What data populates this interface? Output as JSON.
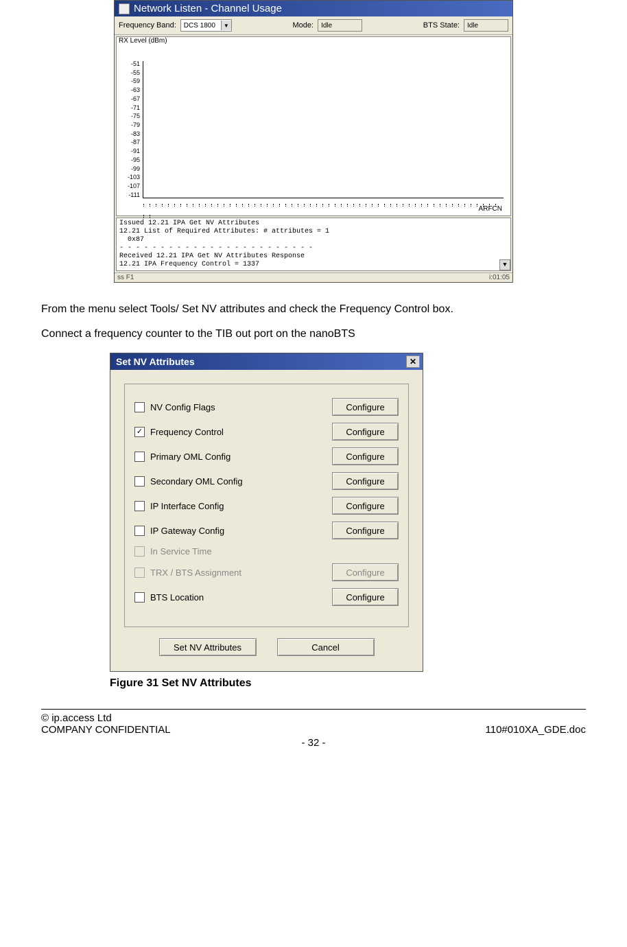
{
  "win1": {
    "title": "Network Listen - Channel Usage",
    "freq_band_label": "Frequency Band:",
    "freq_band_value": "DCS 1800",
    "mode_label": "Mode:",
    "mode_value": "Idle",
    "bts_state_label": "BTS State:",
    "bts_state_value": "Idle",
    "chart_title": "RX Level (dBm)",
    "xlabel": "ARFCN",
    "log": "Issued 12.21 IPA Get NV Attributes\n12.21 List of Required Attributes: # attributes = 1\n  0x87\n- - - - - - - - - - - - - - - - - - - - - - - -\nReceived 12.21 IPA Get NV Attributes Response\n12.21 IPA Frequency Control = 1337",
    "status_left": "ss F1",
    "status_right": "i:01:05"
  },
  "para1": "From the menu select Tools/ Set NV attributes and check the Frequency Control box.",
  "para2": "Connect a frequency counter to the TIB out port on the nanoBTS",
  "win2": {
    "title": "Set NV Attributes",
    "rows": [
      {
        "label": "NV Config Flags",
        "checked": false,
        "disabled": false,
        "btn": "Configure",
        "btn_disabled": false
      },
      {
        "label": "Frequency Control",
        "checked": true,
        "disabled": false,
        "btn": "Configure",
        "btn_disabled": false
      },
      {
        "label": "Primary OML Config",
        "checked": false,
        "disabled": false,
        "btn": "Configure",
        "btn_disabled": false
      },
      {
        "label": "Secondary OML Config",
        "checked": false,
        "disabled": false,
        "btn": "Configure",
        "btn_disabled": false
      },
      {
        "label": "IP Interface Config",
        "checked": false,
        "disabled": false,
        "btn": "Configure",
        "btn_disabled": false
      },
      {
        "label": "IP Gateway Config",
        "checked": false,
        "disabled": false,
        "btn": "Configure",
        "btn_disabled": false
      },
      {
        "label": "In Service Time",
        "checked": false,
        "disabled": true,
        "btn": "",
        "btn_disabled": true
      },
      {
        "label": "TRX / BTS Assignment",
        "checked": false,
        "disabled": true,
        "btn": "Configure",
        "btn_disabled": true
      },
      {
        "label": "BTS Location",
        "checked": false,
        "disabled": false,
        "btn": "Configure",
        "btn_disabled": false
      }
    ],
    "set_btn": "Set NV Attributes",
    "cancel_btn": "Cancel"
  },
  "figcap": "Figure 31 Set NV Attributes",
  "footer": {
    "copyright": "© ip.access Ltd",
    "conf": "COMPANY CONFIDENTIAL",
    "doc": "110#010XA_GDE.doc",
    "page": "- 32 -"
  },
  "chart_data": {
    "type": "bar",
    "title": "RX Level (dBm)",
    "xlabel": "ARFCN",
    "ylabel": "",
    "y_ticks": [
      -51,
      -55,
      -59,
      -63,
      -67,
      -71,
      -75,
      -79,
      -83,
      -87,
      -91,
      -95,
      -99,
      -103,
      -107,
      -111
    ],
    "ylim": [
      -111,
      -51
    ],
    "series": [
      {
        "name": "RX Level",
        "values": []
      }
    ],
    "note": "no bars plotted in screenshot"
  }
}
